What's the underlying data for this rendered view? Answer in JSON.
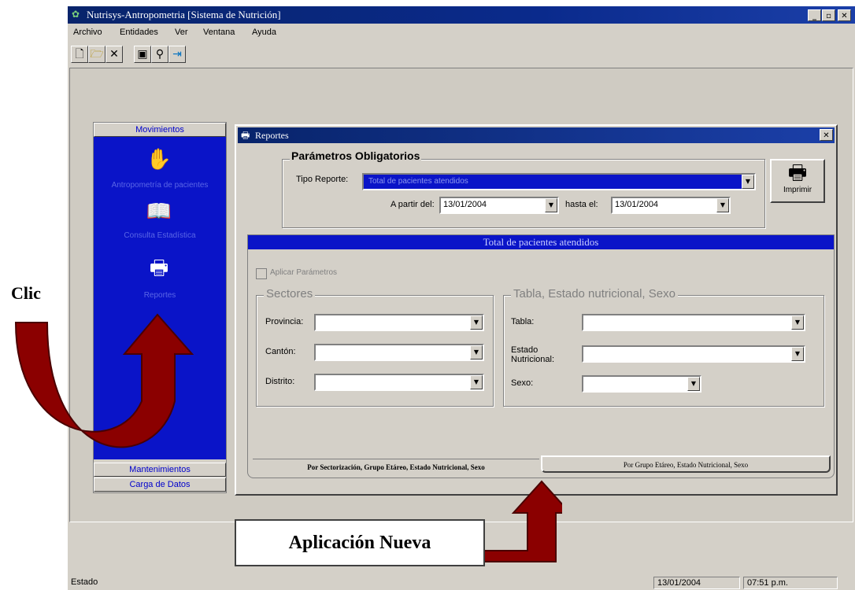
{
  "app": {
    "title": "Nutrisys-Antropometria [Sistema de Nutrición]",
    "controls": [
      "_",
      "▫",
      "✕"
    ]
  },
  "menu": [
    "Archivo",
    "Entidades",
    "Ver",
    "Ventana",
    "Ayuda"
  ],
  "toolbar": {
    "icons": [
      "new-document-icon",
      "open-folder-icon",
      "delete-icon",
      "save-icon",
      "find-icon",
      "exit-icon"
    ]
  },
  "nav": {
    "header": "Movimientos",
    "items": [
      {
        "label": "Antropometría de pacientes",
        "icon": "handshake-icon"
      },
      {
        "label": "Consulta Estadística",
        "icon": "book-icon"
      },
      {
        "label": "Reportes",
        "icon": "printer-icon"
      }
    ],
    "footer": [
      "Mantenimientos",
      "Carga de Datos"
    ]
  },
  "reportes": {
    "title": "Reportes",
    "close": "✕",
    "obligatorios": {
      "heading": "Parámetros Obligatorios",
      "tipo_label": "Tipo Reporte:",
      "tipo_value": "Total de pacientes atendidos",
      "desde_label": "A partir del:",
      "desde_value": "13/01/2004",
      "hasta_label": "hasta el:",
      "hasta_value": "13/01/2004"
    },
    "imprimir": "Imprimir",
    "panel_title": "Total de pacientes atendidos",
    "aplicar": "Aplicar Parámetros",
    "sectores": {
      "heading": "Sectores",
      "provincia": "Provincia:",
      "canton": "Cantón:",
      "distrito": "Distrito:"
    },
    "tabla_group": {
      "heading": "Tabla, Estado nutricional, Sexo",
      "tabla": "Tabla:",
      "estado": "Estado Nutricional:",
      "sexo": "Sexo:"
    },
    "tabs": [
      "Por Sectorización, Grupo Etáreo, Estado Nutricional, Sexo",
      "Por Grupo Etáreo, Estado Nutricional, Sexo"
    ]
  },
  "annotations": {
    "clic": "Clic",
    "nueva": "Aplicación Nueva",
    "arrow_color": "#8b0000"
  },
  "status": {
    "label": "Estado",
    "date": "13/01/2004",
    "time": "07:51 p.m."
  },
  "colors": {
    "title_blue": "#08246b",
    "nav_blue": "#0a14c8",
    "face": "#d4d0c8"
  }
}
